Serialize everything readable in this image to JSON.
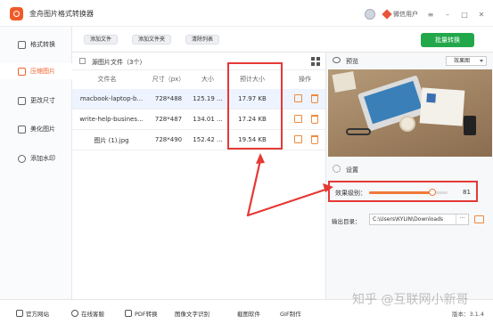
{
  "window": {
    "title": "金舟图片格式转换器",
    "user_label": "微信用户",
    "minimize": "–",
    "maximize": "□",
    "close": "✕",
    "menu": "≡"
  },
  "sidebar": {
    "items": [
      {
        "label": "格式转换",
        "active": false
      },
      {
        "label": "压缩图片",
        "active": true
      },
      {
        "label": "更改尺寸",
        "active": false
      },
      {
        "label": "美化图片",
        "active": false
      },
      {
        "label": "添加水印",
        "active": false
      }
    ]
  },
  "toolbar": {
    "add_file": "添加文件",
    "add_folder": "添加文件夹",
    "clear_list": "清除列表",
    "convert": "批量转换"
  },
  "file_list": {
    "title": "源图片文件（3个）",
    "columns": [
      "文件名",
      "尺寸（px）",
      "大小",
      "预计大小",
      "操作"
    ],
    "rows": [
      {
        "name": "macbook-laptop-b...",
        "dims": "728*488",
        "size": "125.19 ...",
        "est": "17.97 KB"
      },
      {
        "name": "write-help-busines...",
        "dims": "728*487",
        "size": "134.01 ...",
        "est": "17.24 KB"
      },
      {
        "name": "图片 (1).jpg",
        "dims": "728*490",
        "size": "152.42 ...",
        "est": "19.54 KB"
      }
    ]
  },
  "preview": {
    "label": "预览",
    "effect_select": "效果图"
  },
  "settings": {
    "label": "设置",
    "level_label": "效果级别：",
    "level_value": "81",
    "level_fraction": 0.81,
    "output_label": "输出目录：",
    "output_path": "C:\\Users\\KYLIN\\Downloads",
    "more": "···"
  },
  "bottombar": {
    "items": [
      "官方网站",
      "在线客服",
      "PDF转换",
      "图像文字识别",
      "截图软件",
      "GIF制作"
    ],
    "version": "版本：3.1.4"
  },
  "watermark": "知乎 @互联网小新哥",
  "colors": {
    "accent": "#f0612b",
    "convert_green": "#22a84a",
    "highlight_red": "#e53935"
  }
}
